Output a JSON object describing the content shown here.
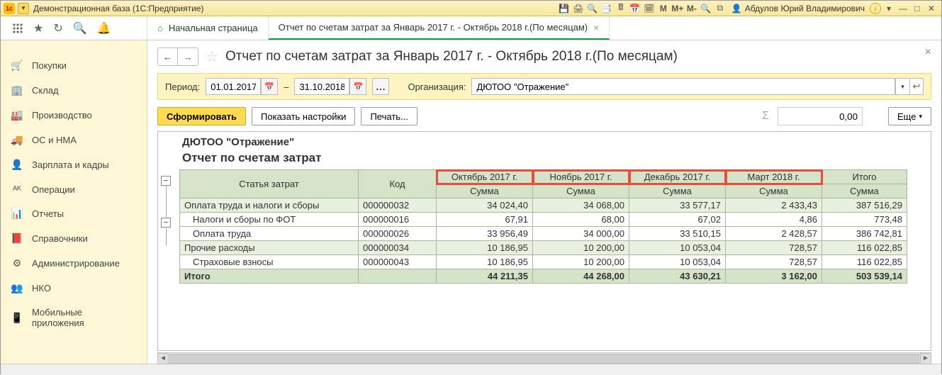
{
  "app": {
    "title": "Демонстрационная база  (1С:Предприятие)",
    "user": "Абдулов Юрий Владимирович"
  },
  "tabs": {
    "home": "Начальная страница",
    "active": "Отчет по счетам затрат за Январь 2017 г. - Октябрь 2018 г.(По месяцам)"
  },
  "sidebar": [
    {
      "icon": "🛒",
      "label": "Покупки"
    },
    {
      "icon": "🏢",
      "label": "Склад"
    },
    {
      "icon": "🏭",
      "label": "Производство"
    },
    {
      "icon": "🚚",
      "label": "ОС и НМА"
    },
    {
      "icon": "👤",
      "label": "Зарплата и кадры"
    },
    {
      "icon": "ᴬᴷ",
      "label": "Операции"
    },
    {
      "icon": "📊",
      "label": "Отчеты"
    },
    {
      "icon": "📕",
      "label": "Справочники"
    },
    {
      "icon": "⚙",
      "label": "Администрирование"
    },
    {
      "icon": "👥",
      "label": "НКО"
    },
    {
      "icon": "📱",
      "label": "Мобильные приложения"
    }
  ],
  "page_title": "Отчет по счетам затрат за Январь 2017 г. - Октябрь 2018 г.(По месяцам)",
  "filter": {
    "period_label": "Период:",
    "date_from": "01.01.2017",
    "dash": "–",
    "date_to": "31.10.2018",
    "org_label": "Организация:",
    "org_value": "ДЮТОО \"Отражение\""
  },
  "actions": {
    "run": "Сформировать",
    "settings": "Показать настройки",
    "print": "Печать...",
    "sum_value": "0,00",
    "more": "Еще"
  },
  "report": {
    "org_title": "ДЮТОО \"Отражение\"",
    "title": "Отчет по счетам затрат",
    "col_item": "Статья затрат",
    "col_code": "Код",
    "months": [
      "Октябрь 2017 г.",
      "Ноябрь 2017 г.",
      "Декабрь 2017 г.",
      "Март 2018 г."
    ],
    "col_total": "Итого",
    "sub_sum": "Сумма",
    "rows": [
      {
        "cls": "grp",
        "name": "Оплата труда и налоги и сборы",
        "code": "000000032",
        "v": [
          "34 024,40",
          "34 068,00",
          "33 577,17",
          "2 433,43",
          "387 516,29"
        ]
      },
      {
        "cls": "",
        "name": "Налоги и сборы по ФОТ",
        "code": "000000016",
        "v": [
          "67,91",
          "68,00",
          "67,02",
          "4,86",
          "773,48"
        ]
      },
      {
        "cls": "",
        "name": "Оплата труда",
        "code": "000000026",
        "v": [
          "33 956,49",
          "34 000,00",
          "33 510,15",
          "2 428,57",
          "386 742,81"
        ]
      },
      {
        "cls": "grp",
        "name": "Прочие расходы",
        "code": "000000034",
        "v": [
          "10 186,95",
          "10 200,00",
          "10 053,04",
          "728,57",
          "116 022,85"
        ]
      },
      {
        "cls": "",
        "name": "Страховые взносы",
        "code": "000000043",
        "v": [
          "10 186,95",
          "10 200,00",
          "10 053,04",
          "728,57",
          "116 022,85"
        ]
      },
      {
        "cls": "total",
        "name": "Итого",
        "code": "",
        "v": [
          "44 211,35",
          "44 268,00",
          "43 630,21",
          "3 162,00",
          "503 539,14"
        ]
      }
    ]
  },
  "chart_data": {
    "type": "table",
    "title": "Отчет по счетам затрат — ДЮТОО \"Отражение\" (Январь 2017 – Октябрь 2018, по месяцам)",
    "columns": [
      "Статья затрат",
      "Код",
      "Октябрь 2017 г.",
      "Ноябрь 2017 г.",
      "Декабрь 2017 г.",
      "Март 2018 г.",
      "Итого"
    ],
    "rows": [
      [
        "Оплата труда и налоги и сборы",
        "000000032",
        34024.4,
        34068.0,
        33577.17,
        2433.43,
        387516.29
      ],
      [
        "Налоги и сборы по ФОТ",
        "000000016",
        67.91,
        68.0,
        67.02,
        4.86,
        773.48
      ],
      [
        "Оплата труда",
        "000000026",
        33956.49,
        34000.0,
        33510.15,
        2428.57,
        386742.81
      ],
      [
        "Прочие расходы",
        "000000034",
        10186.95,
        10200.0,
        10053.04,
        728.57,
        116022.85
      ],
      [
        "Страховые взносы",
        "000000043",
        10186.95,
        10200.0,
        10053.04,
        728.57,
        116022.85
      ],
      [
        "Итого",
        "",
        44211.35,
        44268.0,
        43630.21,
        3162.0,
        503539.14
      ]
    ]
  }
}
